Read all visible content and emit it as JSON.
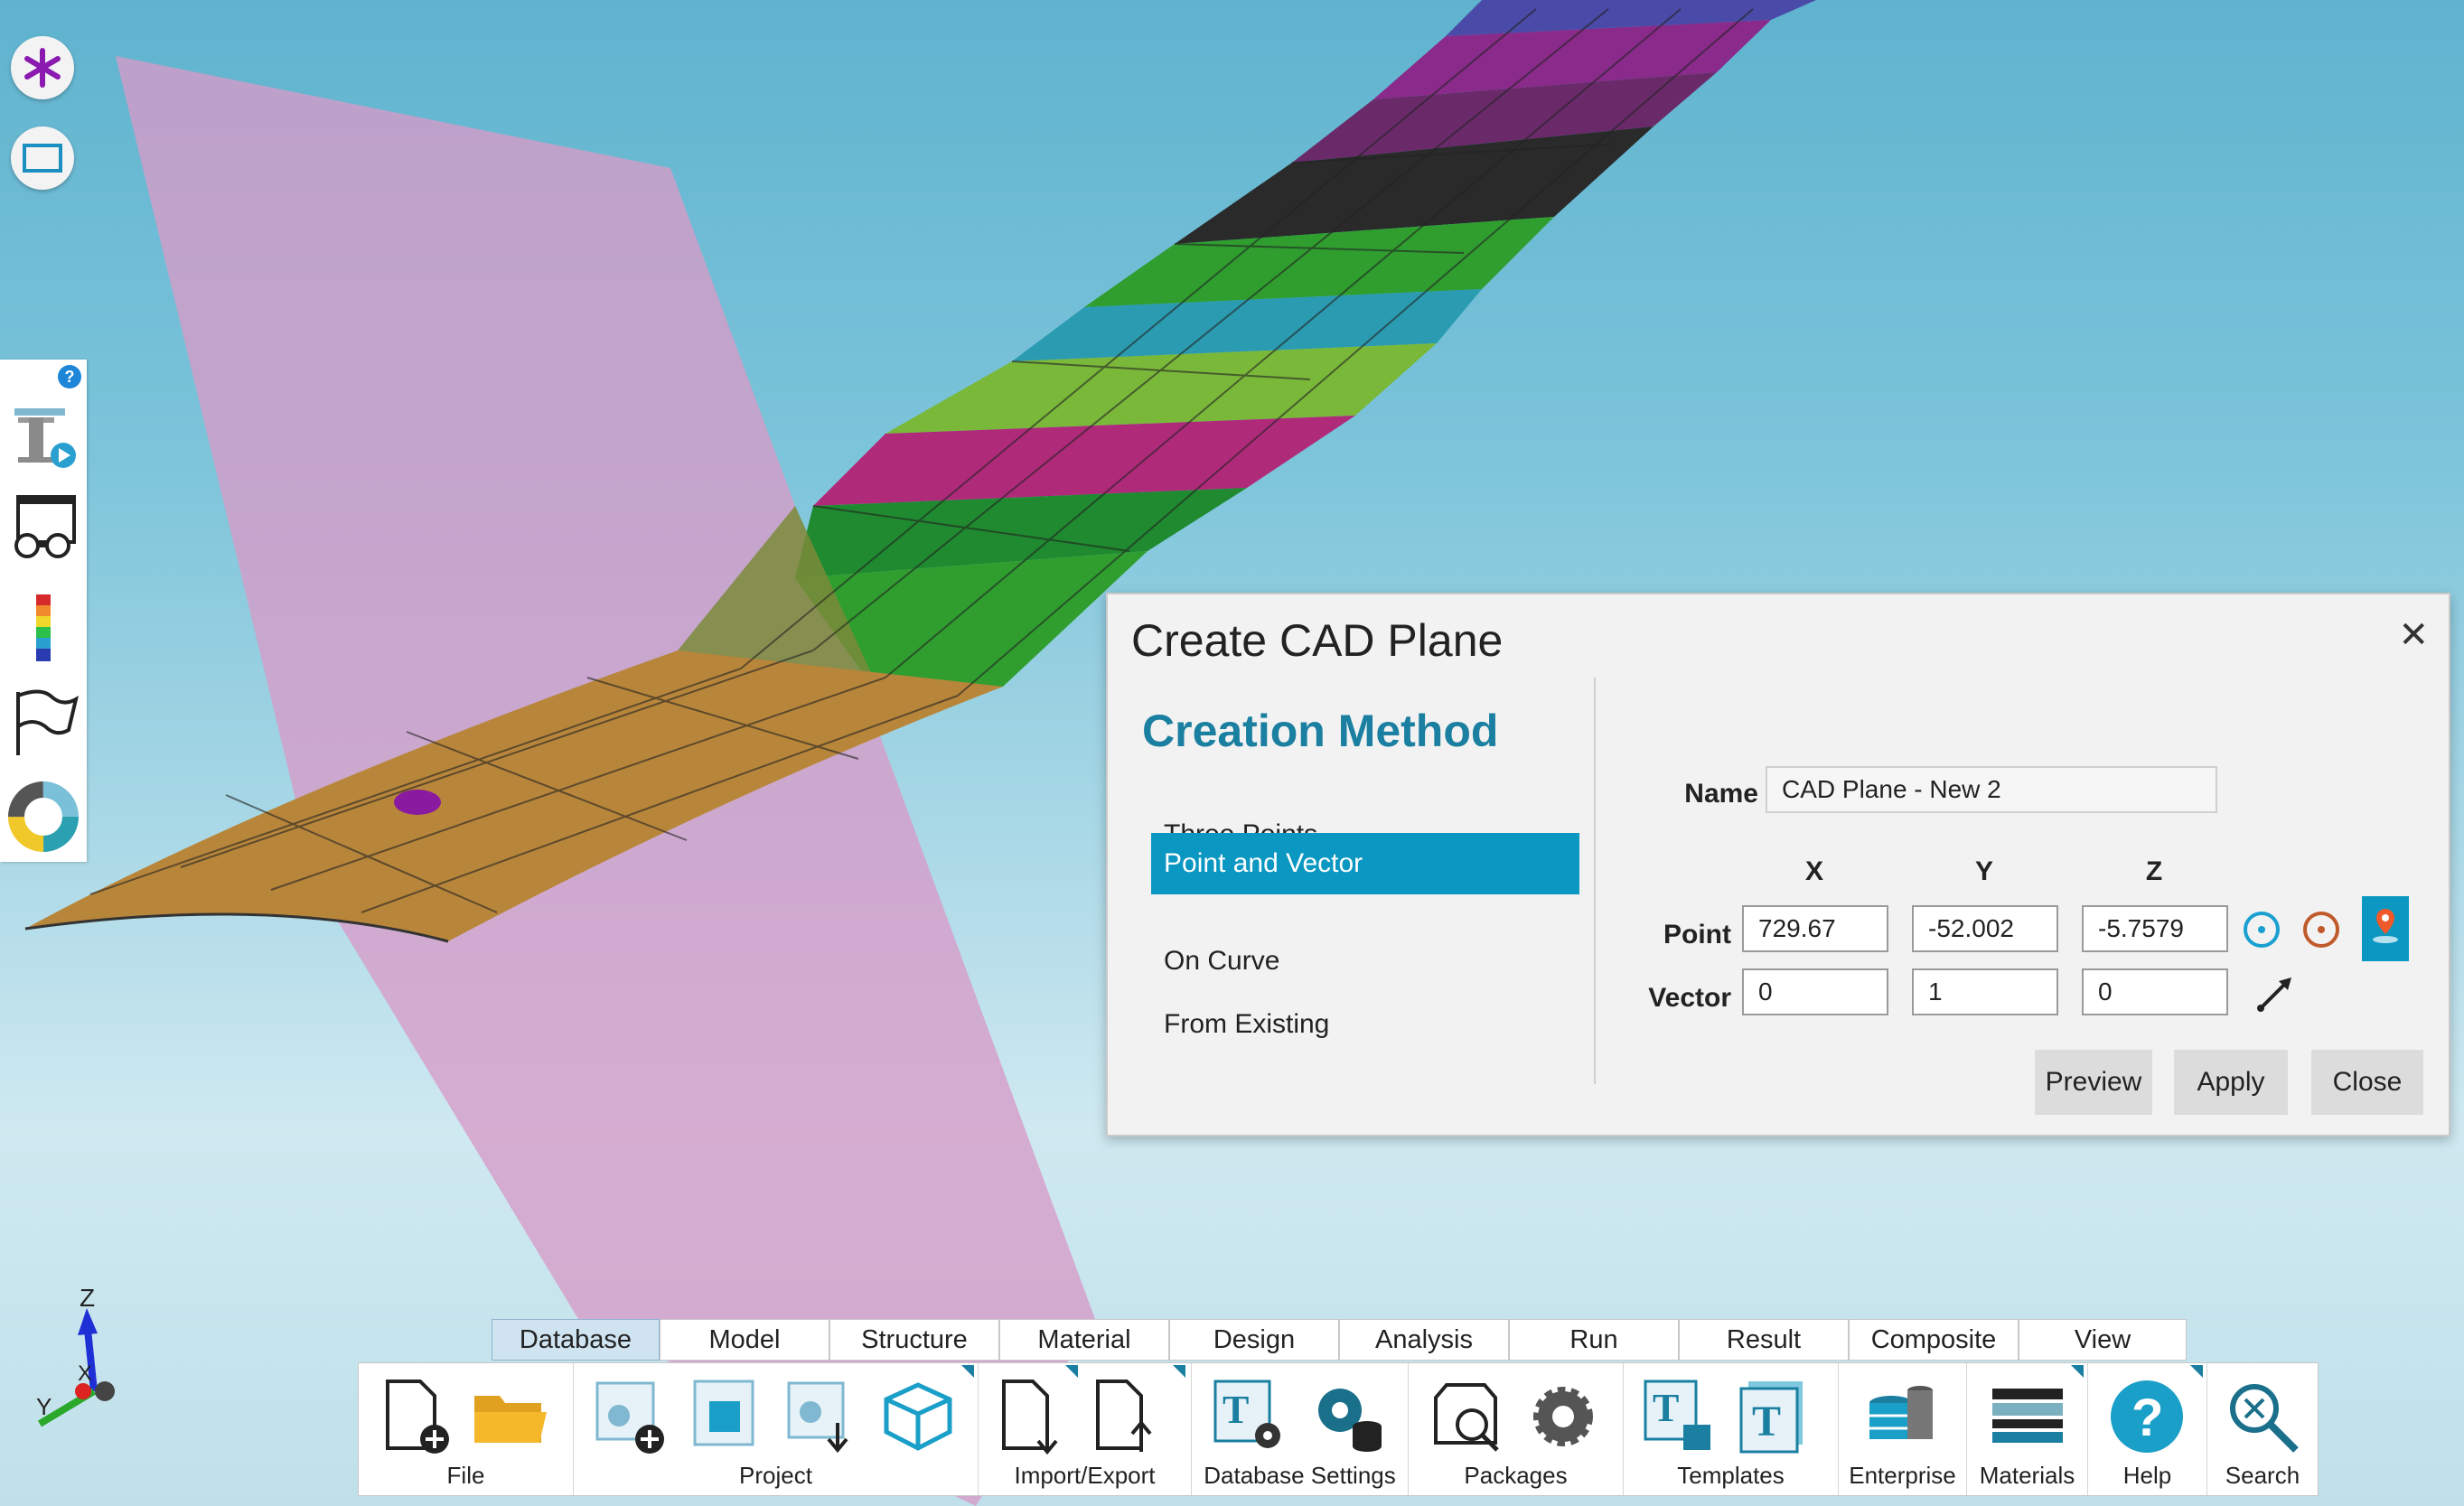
{
  "dialog": {
    "title": "Create CAD Plane",
    "close_glyph": "✕",
    "creation_method_heading": "Creation Method",
    "methods": [
      {
        "label": "Three Points",
        "selected": false
      },
      {
        "label": "Point and Vector",
        "selected": true
      },
      {
        "label": "On Curve",
        "selected": false
      },
      {
        "label": "From Existing",
        "selected": false
      }
    ],
    "name_label": "Name",
    "name_value": "CAD Plane - New 2",
    "col_x": "X",
    "col_y": "Y",
    "col_z": "Z",
    "point_label": "Point",
    "point": {
      "x": "729.67",
      "y": "-52.002",
      "z": "-5.7579"
    },
    "vector_label": "Vector",
    "vector": {
      "x": "0",
      "y": "1",
      "z": "0"
    },
    "buttons": {
      "preview": "Preview",
      "apply": "Apply",
      "close": "Close"
    }
  },
  "ribbon": {
    "tabs": [
      "Database",
      "Model",
      "Structure",
      "Material",
      "Design",
      "Analysis",
      "Run",
      "Result",
      "Composite",
      "View"
    ],
    "active_tab": "Database",
    "groups": {
      "file": "File",
      "project": "Project",
      "import_export": "Import/Export",
      "database_settings": "Database Settings",
      "packages": "Packages",
      "templates": "Templates",
      "enterprise": "Enterprise",
      "materials": "Materials",
      "help": "Help",
      "search": "Search"
    }
  },
  "left_toolbar": {
    "help_badge": "?",
    "icons": [
      "text-play-icon",
      "glasses-window-icon",
      "color-legend-icon",
      "flag-icon",
      "donut-chart-icon"
    ]
  },
  "view_controls": [
    "asterisk-icon",
    "rectangle-select-icon"
  ],
  "axis_triad": {
    "z": "Z",
    "x": "X",
    "y": "Y"
  },
  "colors": {
    "accent": "#0a97c1",
    "heading": "#1a7fa0",
    "plane": "#d79bc8",
    "wing_root": "#b8863a"
  }
}
